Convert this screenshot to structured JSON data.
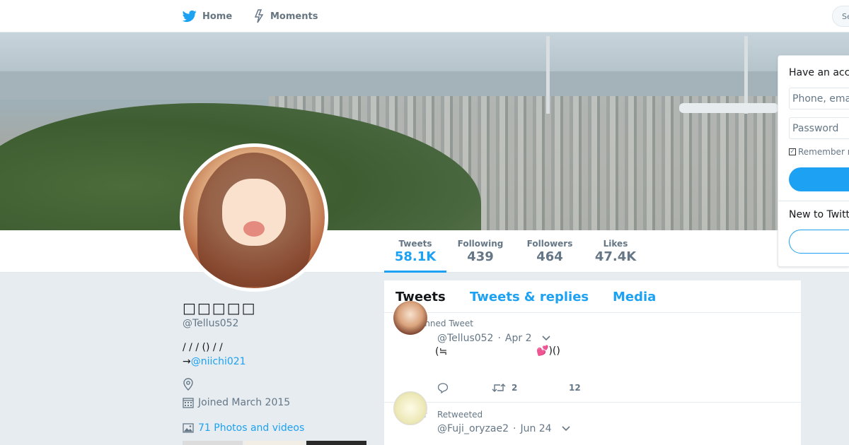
{
  "nav": {
    "home_label": "Home",
    "moments_label": "Moments",
    "search_placeholder": "Se",
    "have_stub": "H"
  },
  "login": {
    "title": "Have an acc",
    "phone_placeholder": "Phone, ema",
    "password_placeholder": "Password",
    "remember_label": "Remember n",
    "login_button": "",
    "new_label": "New to Twitt",
    "signup_button": ""
  },
  "profile": {
    "display_name": "□□□□□",
    "handle": "@Tellus052",
    "bio_line1": "/ / / () / /",
    "bio_prefix": "→",
    "bio_link": "@niichi021",
    "location": "",
    "joined": "Joined March 2015",
    "photos": "71 Photos and videos"
  },
  "stats": [
    {
      "label": "Tweets",
      "value": "58.1K"
    },
    {
      "label": "Following",
      "value": "439"
    },
    {
      "label": "Followers",
      "value": "464"
    },
    {
      "label": "Likes",
      "value": "47.4K"
    }
  ],
  "timeline": {
    "tabs": [
      "Tweets",
      "Tweets & replies",
      "Media"
    ],
    "tweets": [
      {
        "context": "Pinned Tweet",
        "handle": "@Tellus052",
        "date": "Apr 2",
        "text": "(≒",
        "emoji_text": ")()",
        "retweets": "2",
        "likes": "12"
      },
      {
        "context": "Retweeted",
        "handle": "@Fuji_oryzae2",
        "date": "Jun 24"
      }
    ]
  },
  "colors": {
    "accent": "#1da1f2",
    "muted": "#657786",
    "background": "#e6ecf0"
  }
}
